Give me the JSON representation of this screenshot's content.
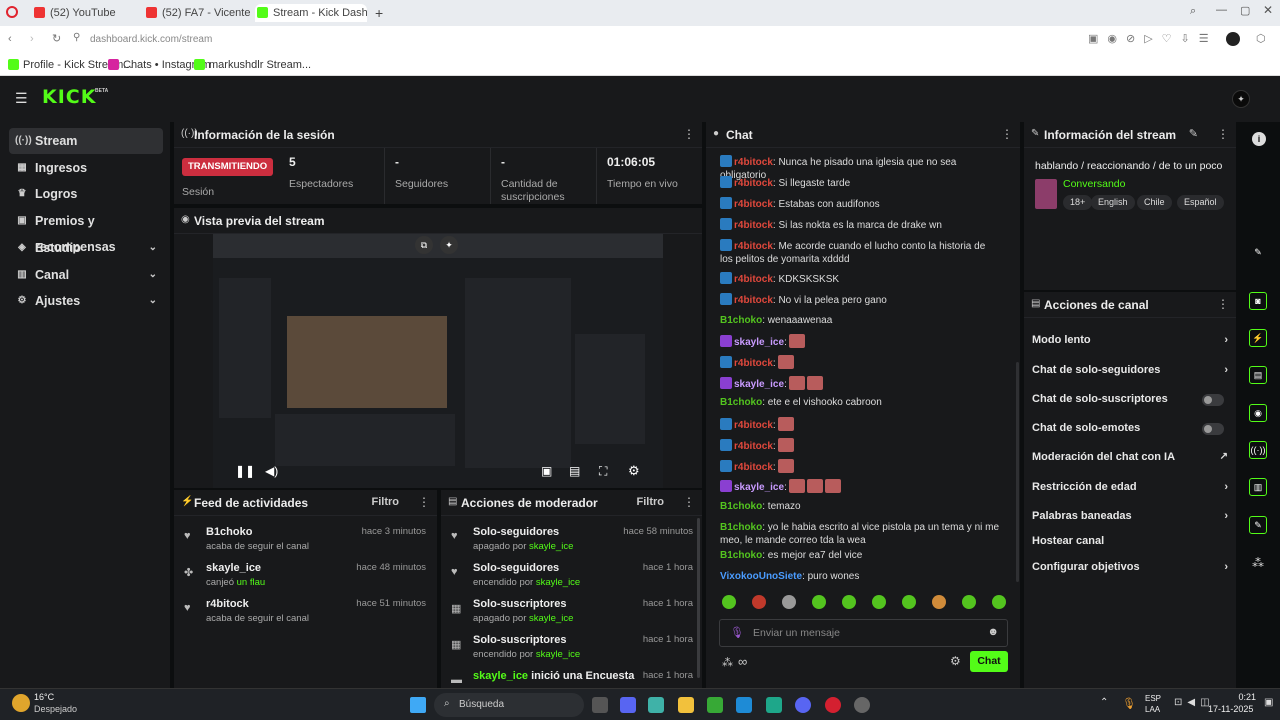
{
  "browser": {
    "tabs": [
      {
        "label": "(52) YouTube",
        "color": "#e33"
      },
      {
        "label": "(52) FA7 - Vicente Prich...",
        "color": "#e33"
      },
      {
        "label": "Stream - Kick Dashboa...",
        "color": "#53fc18"
      }
    ],
    "new_tab": "+",
    "url": "dashboard.kick.com/stream",
    "bookmarks": [
      {
        "label": "Profile - Kick Stream...",
        "color": "#53fc18"
      },
      {
        "label": "Chats • Instagram",
        "color": "#d6249f"
      },
      {
        "label": "markushdlr Stream...",
        "color": "#53fc18"
      }
    ]
  },
  "brand": {
    "logo": "KICK",
    "beta": "BETA",
    "accent": "#53fc18"
  },
  "sidebar": {
    "items": [
      {
        "label": "Stream",
        "icon": "broadcast-icon",
        "glyph": "((·))"
      },
      {
        "label": "Ingresos",
        "icon": "money-icon",
        "glyph": "▦"
      },
      {
        "label": "Logros",
        "icon": "trophy-icon",
        "glyph": "♛"
      },
      {
        "label": "Premios y recompensas",
        "icon": "gift-icon",
        "glyph": "▣"
      },
      {
        "label": "Estudio",
        "icon": "studio-icon",
        "glyph": "◈"
      },
      {
        "label": "Canal",
        "icon": "channel-icon",
        "glyph": "▥"
      },
      {
        "label": "Ajustes",
        "icon": "gear-icon",
        "glyph": "⚙"
      }
    ]
  },
  "session": {
    "title": "Información de la sesión",
    "status": "TRANSMITIENDO",
    "status_label": "Sesión",
    "stats": [
      {
        "value": "5",
        "label": "Espectadores"
      },
      {
        "value": "-",
        "label": "Seguidores"
      },
      {
        "value": "-",
        "label": "Cantidad de suscripciones"
      },
      {
        "value": "01:06:05",
        "label": "Tiempo en vivo"
      }
    ]
  },
  "preview": {
    "title": "Vista previa del stream"
  },
  "activity": {
    "title": "Feed de actividades",
    "filter": "Filtro",
    "items": [
      {
        "name": "B1choko",
        "sub": "acaba de seguir el canal",
        "time": "hace 3 minutos",
        "icon": "heart-icon",
        "glyph": "♥"
      },
      {
        "name": "skayle_ice",
        "sub": "canjeó",
        "sub_highlight": "un flau",
        "time": "hace 48 minutos",
        "icon": "reward-icon",
        "glyph": "✤"
      },
      {
        "name": "r4bitock",
        "sub": "acaba de seguir el canal",
        "time": "hace 51 minutos",
        "icon": "heart-icon",
        "glyph": "♥"
      }
    ]
  },
  "modactions": {
    "title": "Acciones de moderador",
    "filter": "Filtro",
    "items": [
      {
        "name": "Solo-seguidores",
        "state": "apagado por",
        "by": "skayle_ice",
        "time": "hace 58 minutos",
        "glyph": "♥"
      },
      {
        "name": "Solo-seguidores",
        "state": "encendido por",
        "by": "skayle_ice",
        "time": "hace 1 hora",
        "glyph": "♥"
      },
      {
        "name": "Solo-suscriptores",
        "state": "apagado por",
        "by": "skayle_ice",
        "time": "hace 1 hora",
        "glyph": "▦"
      },
      {
        "name": "Solo-suscriptores",
        "state": "encendido por",
        "by": "skayle_ice",
        "time": "hace 1 hora",
        "glyph": "▦"
      },
      {
        "name_green": "skayle_ice",
        "name": "inició una Encuesta",
        "time": "hace 1 hora",
        "glyph": "▬"
      }
    ]
  },
  "chat": {
    "title": "Chat",
    "messages": [
      {
        "user": "r4bitock",
        "color": "#e0483c",
        "badge": "#2a7bbf",
        "text": ": Nunca he pisado una iglesia que no sea obligatorio"
      },
      {
        "user": "r4bitock",
        "color": "#e0483c",
        "badge": "#2a7bbf",
        "text": ": Si llegaste tarde"
      },
      {
        "user": "r4bitock",
        "color": "#e0483c",
        "badge": "#2a7bbf",
        "text": ": Estabas con audifonos"
      },
      {
        "user": "r4bitock",
        "color": "#e0483c",
        "badge": "#2a7bbf",
        "text": ": Si las nokta es la marca de drake wn"
      },
      {
        "user": "r4bitock",
        "color": "#e0483c",
        "badge": "#2a7bbf",
        "text": ": Me acorde cuando el lucho conto la historia de los pelitos de yomarita xdddd"
      },
      {
        "user": "r4bitock",
        "color": "#e0483c",
        "badge": "#2a7bbf",
        "text": ": KDKSKSKSK"
      },
      {
        "user": "r4bitock",
        "color": "#e0483c",
        "badge": "#2a7bbf",
        "text": ": No vi la pelea pero gano"
      },
      {
        "user": "B1choko",
        "color": "#53c41f",
        "badge": "",
        "text": ": wenaaawenaa"
      },
      {
        "user": "skayle_ice",
        "color": "#c99bff",
        "badge": "#8a3fd1",
        "text": ":",
        "emotes": 1
      },
      {
        "user": "r4bitock",
        "color": "#e0483c",
        "badge": "#2a7bbf",
        "text": ":",
        "emotes": 1
      },
      {
        "user": "skayle_ice",
        "color": "#c99bff",
        "badge": "#8a3fd1",
        "text": ":",
        "emotes": 2
      },
      {
        "user": "B1choko",
        "color": "#53c41f",
        "badge": "",
        "text": ": ete e el vishooko cabroon"
      },
      {
        "user": "r4bitock",
        "color": "#e0483c",
        "badge": "#2a7bbf",
        "text": ":",
        "emotes": 1
      },
      {
        "user": "r4bitock",
        "color": "#e0483c",
        "badge": "#2a7bbf",
        "text": ":",
        "emotes": 1
      },
      {
        "user": "r4bitock",
        "color": "#e0483c",
        "badge": "#2a7bbf",
        "text": ":",
        "emotes": 1
      },
      {
        "user": "skayle_ice",
        "color": "#c99bff",
        "badge": "#8a3fd1",
        "text": ":",
        "emotes": 3
      },
      {
        "user": "B1choko",
        "color": "#53c41f",
        "badge": "",
        "text": ": temazo"
      },
      {
        "user": "B1choko",
        "color": "#53c41f",
        "badge": "",
        "text": ": yo le habia escrito al vice pistola pa un tema y ni me meo, le mande correo tda la wea"
      },
      {
        "user": "B1choko",
        "color": "#53c41f",
        "badge": "",
        "text": ": es mejor ea7 del vice"
      },
      {
        "user": "VixokooUnoSiete",
        "color": "#4a9cff",
        "badge": "",
        "text": ": puro wones"
      }
    ],
    "input_placeholder": "Enviar un mensaje",
    "send_label": "Chat",
    "infinity": "∞"
  },
  "stream_info": {
    "title": "Información del stream",
    "stream_title": "hablando / reaccionando / de to un poco",
    "category": "Conversando",
    "tags": [
      "18+",
      "English",
      "Chile",
      "Español"
    ]
  },
  "channel_actions": {
    "title": "Acciones de canal",
    "items": [
      {
        "label": "Modo lento",
        "kind": "arrow"
      },
      {
        "label": "Chat de solo-seguidores",
        "kind": "arrow"
      },
      {
        "label": "Chat de solo-suscriptores",
        "kind": "toggle"
      },
      {
        "label": "Chat de solo-emotes",
        "kind": "toggle"
      },
      {
        "label": "Moderación del chat con IA",
        "kind": "external"
      },
      {
        "label": "Restricción de edad",
        "kind": "arrow"
      },
      {
        "label": "Palabras baneadas",
        "kind": "arrow"
      },
      {
        "label": "Hostear canal",
        "kind": "none"
      },
      {
        "label": "Configurar objetivos",
        "kind": "arrow"
      }
    ]
  },
  "taskbar": {
    "weather_temp": "16°C",
    "weather_desc": "Despejado",
    "search": "Búsqueda",
    "lang1": "ESP",
    "lang2": "LAA",
    "time": "0:21",
    "date": "17-11-2025"
  }
}
